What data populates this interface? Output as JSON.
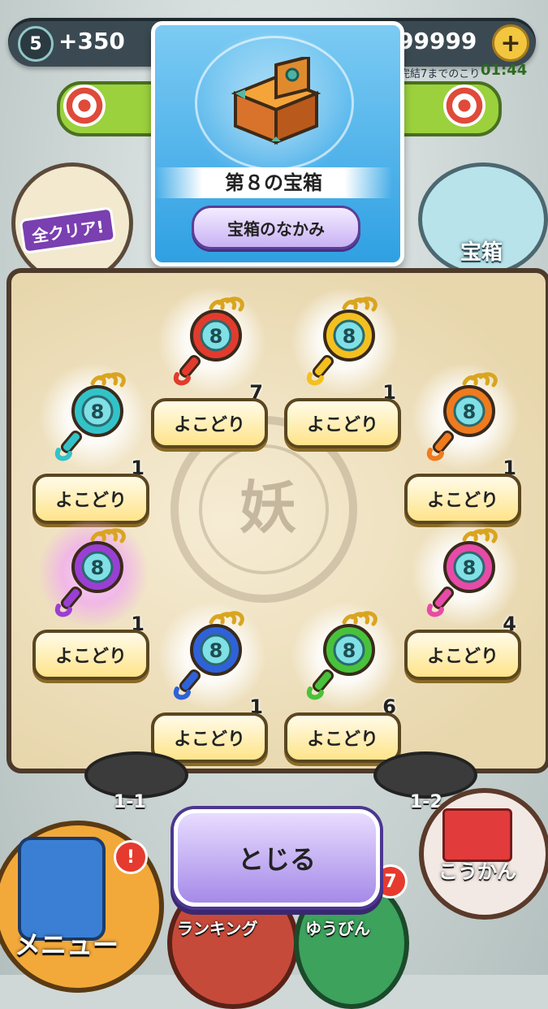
{
  "header": {
    "level": "5",
    "exp_gain": "+350",
    "money": "99999",
    "plus_label": "+",
    "timer_label": "完結7までのこり",
    "timer_value": "01:44"
  },
  "side": {
    "all_clear_label": "全クリア!",
    "chest_label": "宝箱"
  },
  "treasure_card": {
    "title": "第８の宝箱",
    "contents_button": "宝箱のなかみ"
  },
  "scroll": {
    "seal_mark": "妖"
  },
  "items": [
    {
      "color": "#e23b2e",
      "count": "7",
      "button": "よこどり"
    },
    {
      "color": "#f3c01f",
      "count": "1",
      "button": "よこどり"
    },
    {
      "color": "#32c3c9",
      "count": "1",
      "button": "よこどり"
    },
    {
      "color": "#f07a1e",
      "count": "1",
      "button": "よこどり"
    },
    {
      "color": "#9b3fd4",
      "count": "1",
      "button": "よこどり"
    },
    {
      "color": "#e84aa8",
      "count": "4",
      "button": "よこどり"
    },
    {
      "color": "#2f62d8",
      "count": "1",
      "button": "よこどり"
    },
    {
      "color": "#48c23a",
      "count": "6",
      "button": "よこどり"
    }
  ],
  "stages": {
    "left": "1-1",
    "right": "1-2"
  },
  "bottom": {
    "close_button": "とじる",
    "menu_label": "メニュー",
    "menu_badge": "!",
    "ranking_label": "ランキング",
    "mail_label": "ゆうびん",
    "mail_badge": "7",
    "exchange_label": "こうかん"
  }
}
